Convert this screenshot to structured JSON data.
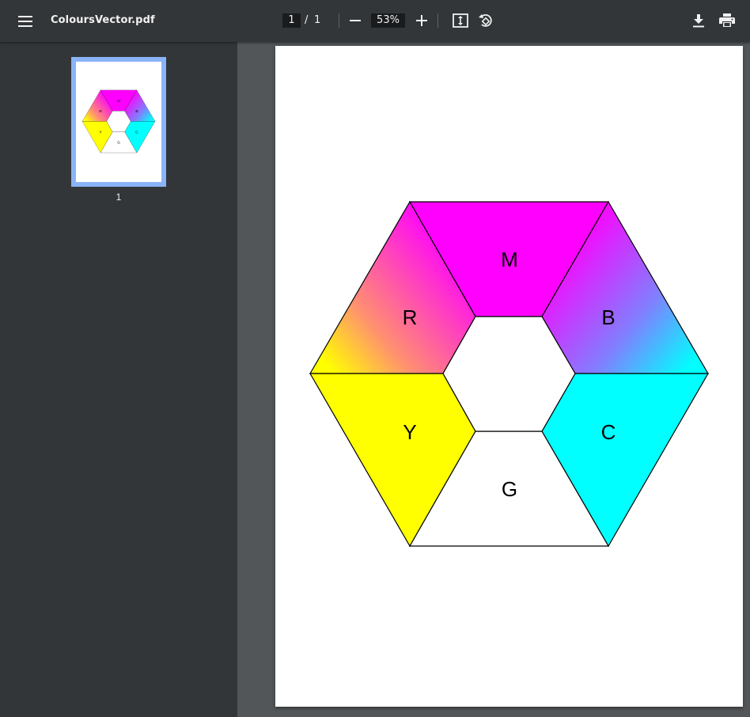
{
  "toolbar": {
    "file_name": "ColoursVector.pdf",
    "current_page": "1",
    "page_separator": "/",
    "total_pages": "1",
    "zoom": "53%",
    "icons": [
      "menu-icon",
      "minus-icon",
      "plus-icon",
      "fit-page-icon",
      "rotate-icon",
      "download-icon",
      "print-icon"
    ]
  },
  "sidebar": {
    "thumbnails": [
      {
        "label": "1"
      }
    ]
  },
  "document": {
    "segments": [
      {
        "label": "M",
        "color": "#ff00ff"
      },
      {
        "label": "R",
        "colors": [
          "#ff00ff",
          "#ffff00"
        ]
      },
      {
        "label": "B",
        "colors": [
          "#ff00ff",
          "#00ffff"
        ]
      },
      {
        "label": "Y",
        "color": "#ffff00"
      },
      {
        "label": "C",
        "color": "#00ffff"
      },
      {
        "label": "G",
        "color": "#ffffff"
      }
    ]
  },
  "colors": {
    "toolbar_bg": "#323639",
    "viewer_bg": "#525659",
    "thumb_selected": "#8ab4f8"
  }
}
